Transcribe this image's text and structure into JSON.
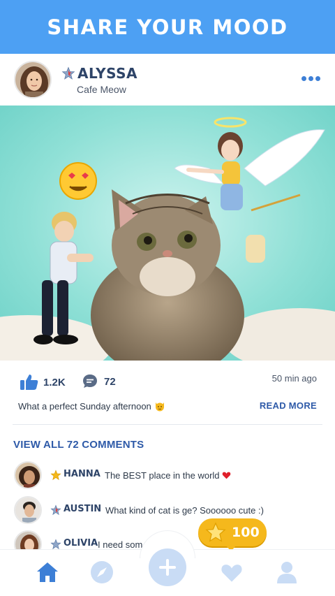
{
  "banner": {
    "title": "SHARE YOUR MOOD"
  },
  "post": {
    "user_name": "ALYSSA",
    "location": "Cafe Meow",
    "likes": "1.2K",
    "comments_count": "72",
    "time_ago": "50 min ago",
    "caption": "What a perfect Sunday afternoon",
    "read_more": "READ MORE"
  },
  "comments_section": {
    "view_all": "VIEW ALL 72 COMMENTS",
    "items": [
      {
        "name": "HANNA",
        "text": "The BEST place in the world",
        "star": "gold"
      },
      {
        "name": "AUSTIN",
        "text": "What kind of cat is ge? Soooooo cute :)",
        "star": "red"
      },
      {
        "name": "OLIVIA",
        "text": "I need som",
        "star": "silver"
      }
    ]
  },
  "reward": {
    "coins": "100"
  },
  "nav": {
    "items": [
      "home-icon",
      "explore-icon",
      "add-icon",
      "favorites-icon",
      "profile-icon"
    ]
  },
  "colors": {
    "banner": "#4da0f3",
    "accent": "#3d7fd6",
    "text_dark": "#2e4468",
    "coin": "#f5b81c"
  }
}
